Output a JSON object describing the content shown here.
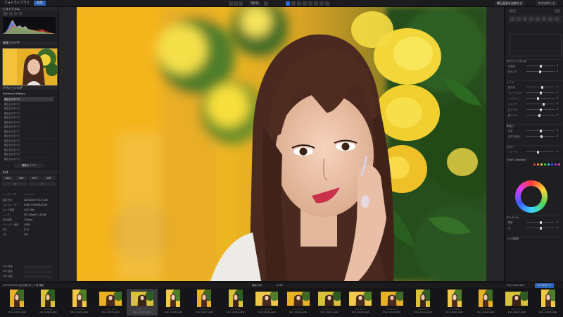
{
  "topbar": {
    "app_title": "フォトライブラリ",
    "active_tab": "編集",
    "zoom_label": "50 %",
    "btn_compare": "補正画面を比較する",
    "btn_export": "エクスポート"
  },
  "left": {
    "histogram_title": "ヒストグラム",
    "navigator_title": "画像ブラウザ",
    "history_title": "アクションログ",
    "history_header": "Advanced History",
    "history_items": [
      "補正元のすべて",
      "補正元のすべて",
      "補正元のすべて",
      "補正元のすべて",
      "補正元のすべて",
      "補正元のすべて",
      "補正元のすべて",
      "補正元のすべて",
      "補正元のすべて",
      "補正元のすべて",
      "補正元のすべて",
      "補正元のすべて",
      "補正元のすべて",
      "補正元のすべて"
    ],
    "history_clear": "履歴をクリア",
    "info_title": "Exif",
    "rating_label": "レーティング",
    "info_rows": [
      {
        "k": "撮影日時",
        "v": "2024/05/29 13:21:46"
      },
      {
        "k": "カメラメーカー",
        "v": "SONY CORPORATION"
      },
      {
        "k": "カメラ機種",
        "v": "ILCE-7M4"
      },
      {
        "k": "レンズ",
        "v": "FE 135mm F1.8 GM"
      },
      {
        "k": "焦点距離",
        "v": "135mm"
      },
      {
        "k": "シャッター速度",
        "v": "1/500"
      },
      {
        "k": "絞り",
        "v": "F1.8"
      },
      {
        "k": "ISO",
        "v": "100"
      }
    ],
    "bottom_labels": [
      "GPS 緯度",
      "GPS 経度",
      "GPS 高度"
    ]
  },
  "right": {
    "sections": [
      "ホワイトバランス",
      "トーン",
      "明るさ",
      "カラー",
      "ディテール",
      "ノイズ除去",
      "Color Collection"
    ],
    "sliders": [
      {
        "label": "色温度",
        "value": "0"
      },
      {
        "label": "色かぶり",
        "value": "0"
      },
      {
        "label": "露光量",
        "value": "0"
      },
      {
        "label": "コントラスト",
        "value": "0"
      },
      {
        "label": "ハイライト",
        "value": "0"
      },
      {
        "label": "シャドウ",
        "value": "0"
      },
      {
        "label": "白レベル",
        "value": "0"
      },
      {
        "label": "黒レベル",
        "value": "0"
      },
      {
        "label": "彩度",
        "value": "0"
      },
      {
        "label": "自然な彩度",
        "value": "0"
      },
      {
        "label": "シャープ",
        "value": "0"
      },
      {
        "label": "輝度",
        "value": "0"
      },
      {
        "label": "色",
        "value": "0"
      }
    ]
  },
  "filmbar": {
    "path": "2024/05/29 比企丘陵 花と人物 撮影",
    "sort_label": "撮影日時",
    "count": "1/200",
    "filter_label": "Film Collection",
    "export_button": "エクスポート"
  },
  "filmstrip": [
    {
      "name": "DSC_04031.ARW",
      "land": false,
      "sel": false
    },
    {
      "name": "DSC_04032.ARW",
      "land": false,
      "sel": false
    },
    {
      "name": "DSC_04033.ARW",
      "land": false,
      "sel": false
    },
    {
      "name": "DSC_04034.ARW",
      "land": true,
      "sel": false
    },
    {
      "name": "DSC_04035.ARW",
      "land": true,
      "sel": true
    },
    {
      "name": "DSC_04036.ARW",
      "land": false,
      "sel": false
    },
    {
      "name": "DSC_04037.ARW",
      "land": false,
      "sel": false
    },
    {
      "name": "DSC_04038.ARW",
      "land": false,
      "sel": false
    },
    {
      "name": "DSC_04039.ARW",
      "land": true,
      "sel": false
    },
    {
      "name": "DSC_04040.ARW",
      "land": true,
      "sel": false
    },
    {
      "name": "DSC_04041.ARW",
      "land": true,
      "sel": false
    },
    {
      "name": "DSC_04042.ARW",
      "land": true,
      "sel": false
    },
    {
      "name": "DSC_04043.ARW",
      "land": true,
      "sel": false
    },
    {
      "name": "DSC_04044.ARW",
      "land": false,
      "sel": false
    },
    {
      "name": "DSC_04045.ARW",
      "land": false,
      "sel": false
    },
    {
      "name": "DSC_04046.ARW",
      "land": false,
      "sel": false
    },
    {
      "name": "DSC_04047.ARW",
      "land": true,
      "sel": false
    },
    {
      "name": "DSC_04048.ARW",
      "land": false,
      "sel": false
    }
  ],
  "colors": {
    "accent": "#2a62b8",
    "panel": "#1f1f22",
    "background": "#141416"
  }
}
